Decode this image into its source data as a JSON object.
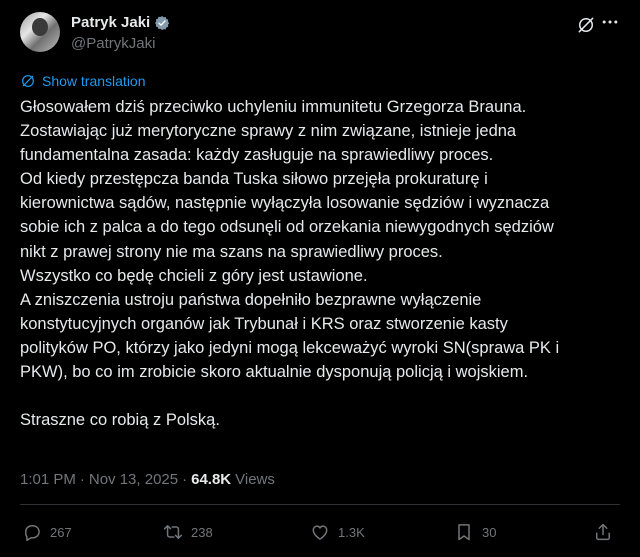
{
  "author": {
    "display_name": "Patryk Jaki",
    "handle": "@PatrykJaki",
    "verified": true
  },
  "translate": {
    "label": "Show translation"
  },
  "tweet": {
    "lines": [
      "Głosowałem dziś przeciwko uchyleniu immunitetu Grzegorza Brauna.",
      "Zostawiając już merytoryczne sprawy z nim związane, istnieje jedna",
      "fundamentalna zasada: każdy zasługuje na sprawiedliwy proces.",
      "Od kiedy przestępcza banda Tuska siłowo przejęła prokuraturę i",
      "kierownictwa sądów, następnie wyłączyła losowanie sędziów i wyznacza",
      "sobie ich z palca a do tego odsunęli od orzekania niewygodnych sędziów",
      "nikt z prawej strony nie ma szans na sprawiedliwy proces.",
      "Wszystko co będę chcieli z góry jest ustawione.",
      "A zniszczenia ustroju państwa dopełniło bezprawne wyłączenie",
      "konstytucyjnych organów jak Trybunał i KRS oraz stworzenie kasty",
      "polityków PO, którzy jako jedyni mogą lekceważyć wyroki SN(sprawa PK i",
      "PKW), bo co im zrobicie skoro aktualnie dysponują policją i wojskiem.",
      "",
      "Straszne co robią z Polską."
    ]
  },
  "meta": {
    "time": "1:01 PM",
    "separator": "·",
    "date": "Nov 13, 2025",
    "views_count": "64.8K",
    "views_label": "Views"
  },
  "actions": {
    "replies": "267",
    "reposts": "238",
    "likes": "1.3K",
    "bookmarks": "30"
  },
  "colors": {
    "background": "#000000",
    "text": "#e7e9ea",
    "muted": "#71767b",
    "link": "#1d9bf0",
    "verified": "#829aab"
  },
  "icons": {
    "verified": "verified-badge-icon",
    "grok": "grok-icon",
    "translate": "globe-icon",
    "reply": "reply-icon",
    "repost": "repost-icon",
    "like": "heart-icon",
    "bookmark": "bookmark-icon",
    "share": "share-icon"
  }
}
